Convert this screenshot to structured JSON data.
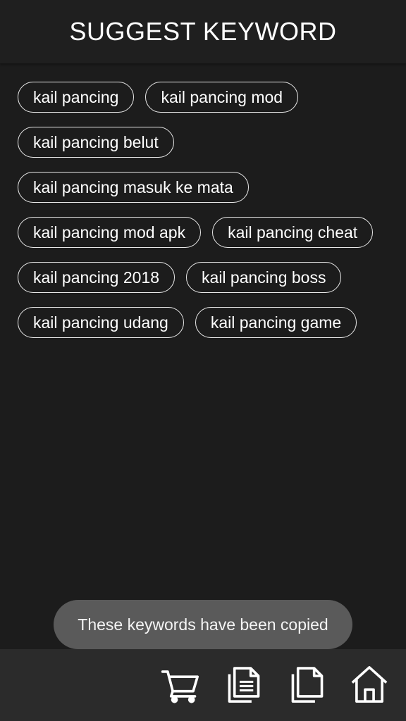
{
  "header": {
    "title": "SUGGEST KEYWORD"
  },
  "keywords": [
    "kail pancing",
    "kail pancing mod",
    "kail pancing belut",
    "kail pancing masuk ke mata",
    "kail pancing mod apk",
    "kail pancing cheat",
    "kail pancing 2018",
    "kail pancing boss",
    "kail pancing udang",
    "kail pancing game"
  ],
  "toast": {
    "message": "These keywords have been copied"
  },
  "bottom_bar": {
    "icons": [
      "cart-icon",
      "document-list-icon",
      "copy-icon",
      "home-icon"
    ]
  },
  "colors": {
    "background": "#1c1c1c",
    "header": "#1f1f1f",
    "chip_border": "#e8e8e8",
    "toast_bg": "#5a5a5a",
    "bottom_bar": "#2b2b2b"
  }
}
